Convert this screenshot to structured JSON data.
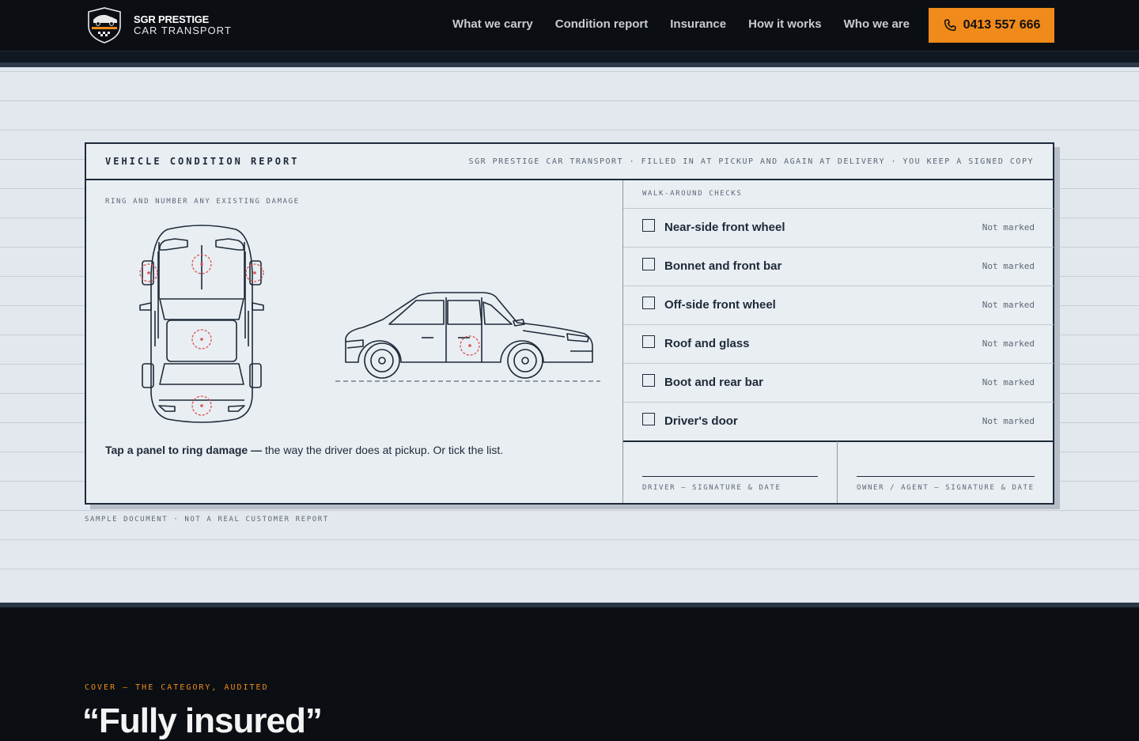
{
  "nav": {
    "brand_line1": "SGR PRESTIGE",
    "brand_line2": "CAR TRANSPORT",
    "links": [
      "What we carry",
      "Condition report",
      "Insurance",
      "How it works",
      "Who we are"
    ],
    "phone": "0413 557 666",
    "accent": "#f08a1a"
  },
  "report": {
    "title": "VEHICLE CONDITION REPORT",
    "meta": "SGR PRESTIGE CAR TRANSPORT · FILLED IN AT PICKUP AND AGAIN AT DELIVERY · YOU KEEP A SIGNED COPY",
    "diagram_label": "RING AND NUMBER ANY EXISTING DAMAGE",
    "hint_bold": "Tap a panel to ring damage —",
    "hint_rest": " the way the driver does at pickup. Or tick the list.",
    "checks_label": "WALK-AROUND CHECKS",
    "checks": [
      {
        "label": "Near-side front wheel",
        "status": "Not marked"
      },
      {
        "label": "Bonnet and front bar",
        "status": "Not marked"
      },
      {
        "label": "Off-side front wheel",
        "status": "Not marked"
      },
      {
        "label": "Roof and glass",
        "status": "Not marked"
      },
      {
        "label": "Boot and rear bar",
        "status": "Not marked"
      },
      {
        "label": "Driver's door",
        "status": "Not marked"
      }
    ],
    "sign_driver": "DRIVER — SIGNATURE & DATE",
    "sign_owner": "OWNER / AGENT — SIGNATURE & DATE",
    "sample_note": "SAMPLE DOCUMENT · NOT A REAL CUSTOMER REPORT",
    "damage_color": "#d9534f"
  },
  "cover": {
    "eyebrow": "COVER — THE CATEGORY, AUDITED",
    "heading": "“Fully insured”"
  }
}
